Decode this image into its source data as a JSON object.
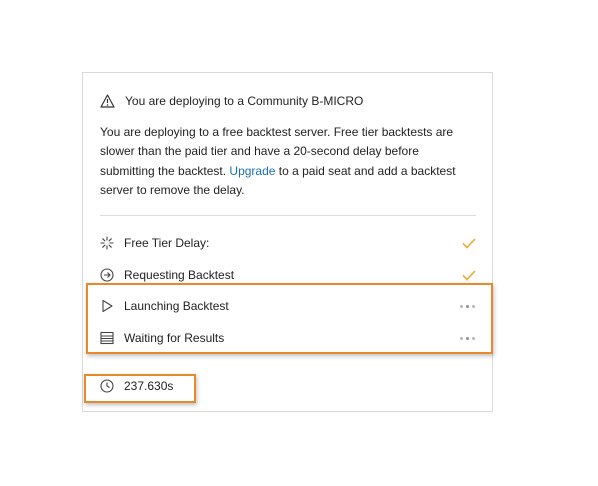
{
  "warning": {
    "title": "You are deploying to a Community B-MICRO",
    "icon": "warning-triangle-icon"
  },
  "description": {
    "text_before": "You are deploying to a free backtest server. Free tier backtests are slower than the paid tier and have a 20-second delay before submitting the backtest. ",
    "link_text": "Upgrade",
    "text_after": " to a paid seat and add a backtest server to remove the delay."
  },
  "steps": [
    {
      "label": "Free Tier Delay:",
      "icon": "spinner-icon",
      "status": "done"
    },
    {
      "label": "Requesting Backtest",
      "icon": "arrow-circle-icon",
      "status": "done"
    },
    {
      "label": "Launching Backtest",
      "icon": "play-icon",
      "status": "pending"
    },
    {
      "label": "Waiting for Results",
      "icon": "list-icon",
      "status": "pending"
    }
  ],
  "timer": {
    "value": "237.630s",
    "icon": "clock-icon"
  },
  "colors": {
    "accent_orange": "#e8892e",
    "check": "#f0a830",
    "link": "#1a6fb5"
  }
}
